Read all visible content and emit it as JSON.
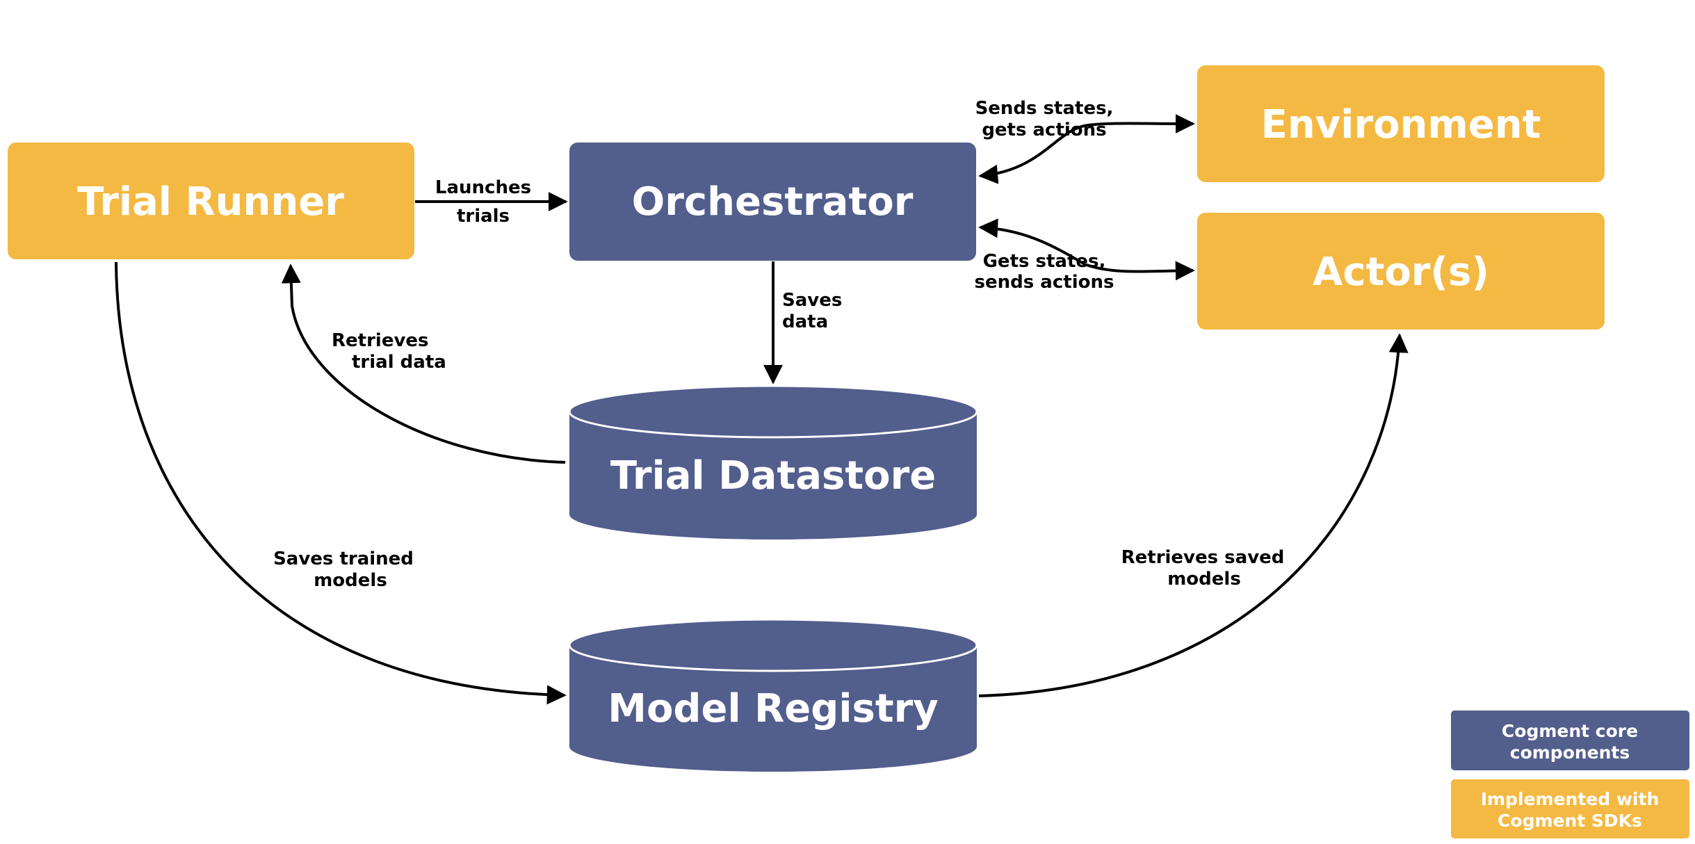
{
  "colors": {
    "core": "#525E8C",
    "sdk": "#F4B942",
    "text_on_box": "#FFFFFF",
    "edge": "#000000",
    "background": "#FFFFFF"
  },
  "nodes": {
    "trial_runner": {
      "label": "Trial Runner",
      "kind": "sdk",
      "shape": "rounded-rect"
    },
    "orchestrator": {
      "label": "Orchestrator",
      "kind": "core",
      "shape": "rounded-rect"
    },
    "environment": {
      "label": "Environment",
      "kind": "sdk",
      "shape": "rounded-rect"
    },
    "actors": {
      "label": "Actor(s)",
      "kind": "sdk",
      "shape": "rounded-rect"
    },
    "trial_datastore": {
      "label": "Trial Datastore",
      "kind": "core",
      "shape": "cylinder"
    },
    "model_registry": {
      "label": "Model Registry",
      "kind": "core",
      "shape": "cylinder"
    }
  },
  "edges": {
    "launches": {
      "from": "trial_runner",
      "to": "orchestrator",
      "lines": [
        "Launches",
        "trials"
      ],
      "direction": "forward"
    },
    "env_link": {
      "from": "orchestrator",
      "to": "environment",
      "lines": [
        "Sends states,",
        "gets actions"
      ],
      "direction": "both"
    },
    "actor_link": {
      "from": "orchestrator",
      "to": "actors",
      "lines": [
        "Gets states,",
        "sends actions"
      ],
      "direction": "both"
    },
    "saves_data": {
      "from": "orchestrator",
      "to": "trial_datastore",
      "lines": [
        "Saves",
        "data"
      ],
      "direction": "forward"
    },
    "retrieves_trial": {
      "from": "trial_datastore",
      "to": "trial_runner",
      "lines": [
        "Retrieves",
        "trial data"
      ],
      "direction": "forward"
    },
    "saves_models": {
      "from": "trial_runner",
      "to": "model_registry",
      "lines": [
        "Saves trained",
        "models"
      ],
      "direction": "forward"
    },
    "retrieves_models": {
      "from": "model_registry",
      "to": "actors",
      "lines": [
        "Retrieves saved",
        "models"
      ],
      "direction": "forward"
    }
  },
  "legend": {
    "core": {
      "lines": [
        "Cogment core",
        "components"
      ]
    },
    "sdk": {
      "lines": [
        "Implemented with",
        "Cogment SDKs"
      ]
    }
  }
}
